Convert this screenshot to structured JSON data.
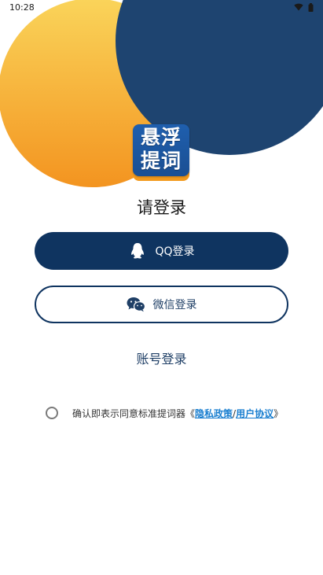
{
  "status_bar": {
    "time": "10:28"
  },
  "logo": {
    "line1": "悬浮",
    "line2": "提词"
  },
  "login": {
    "title": "请登录",
    "qq_button": "QQ登录",
    "wechat_button": "微信登录",
    "account_login": "账号登录"
  },
  "agreement": {
    "prefix": "确认即表示同意标准提词器",
    "open_bracket": "《",
    "privacy_link": "隐私政策",
    "separator": "/",
    "terms_link": "用户协议",
    "close_bracket": "》"
  },
  "colors": {
    "primary": "#0f3460",
    "background_dark_circle": "#1e4470",
    "background_orange_circle": "#f5a623",
    "link": "#1a7fd0"
  },
  "icons": [
    "wifi-icon",
    "battery-icon",
    "qq-penguin-icon",
    "wechat-icon"
  ]
}
